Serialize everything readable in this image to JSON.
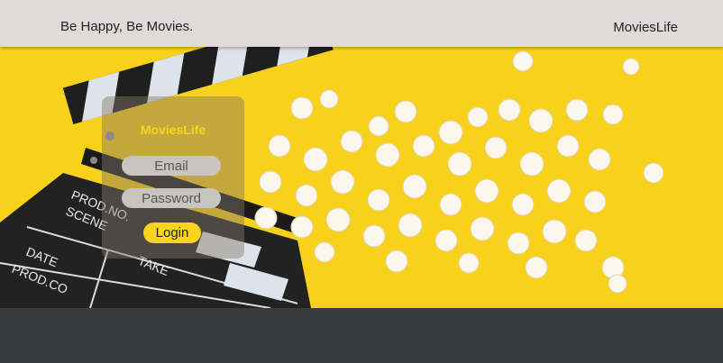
{
  "header": {
    "tagline": "Be Happy, Be Movies.",
    "brand": "MoviesLife"
  },
  "login": {
    "title": "MoviesLife",
    "email_placeholder": "Email",
    "password_placeholder": "Password",
    "login_label": "Login"
  },
  "hero": {
    "background_color": "#f8d21a",
    "clapperboard_labels": [
      "PROD.NO.",
      "SCENE",
      "TAKE",
      "DATE",
      "PROD.CO"
    ]
  },
  "colors": {
    "accent": "#f7d51d",
    "header_bg": "#e1d9da",
    "footer_bg": "#3a3b3d"
  }
}
